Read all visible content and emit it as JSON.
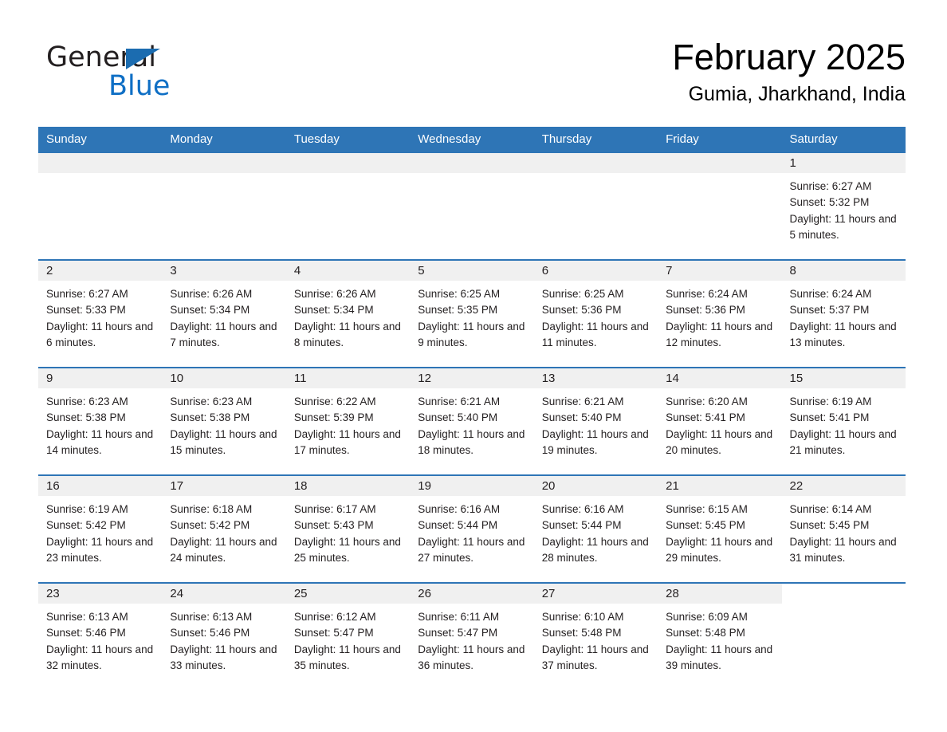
{
  "brand": {
    "name_part1": "General",
    "name_part2": "Blue",
    "triangle_color": "#1b6cb0",
    "blue_color": "#0f6fc5"
  },
  "header": {
    "month_title": "February 2025",
    "location": "Gumia, Jharkhand, India"
  },
  "theme": {
    "header_blue": "#2e75b6",
    "daynum_band_gray": "#f0f0f0",
    "text_color": "#231f20",
    "page_background": "#ffffff"
  },
  "calendar": {
    "weekday_headers": [
      "Sunday",
      "Monday",
      "Tuesday",
      "Wednesday",
      "Thursday",
      "Friday",
      "Saturday"
    ],
    "labels": {
      "sunrise": "Sunrise:",
      "sunset": "Sunset:",
      "daylight": "Daylight:"
    },
    "weeks": [
      [
        {
          "day": "",
          "empty": true
        },
        {
          "day": "",
          "empty": true
        },
        {
          "day": "",
          "empty": true
        },
        {
          "day": "",
          "empty": true
        },
        {
          "day": "",
          "empty": true
        },
        {
          "day": "",
          "empty": true
        },
        {
          "day": "1",
          "sunrise": "Sunrise: 6:27 AM",
          "sunset": "Sunset: 5:32 PM",
          "daylight": "Daylight: 11 hours and 5 minutes."
        }
      ],
      [
        {
          "day": "2",
          "sunrise": "Sunrise: 6:27 AM",
          "sunset": "Sunset: 5:33 PM",
          "daylight": "Daylight: 11 hours and 6 minutes."
        },
        {
          "day": "3",
          "sunrise": "Sunrise: 6:26 AM",
          "sunset": "Sunset: 5:34 PM",
          "daylight": "Daylight: 11 hours and 7 minutes."
        },
        {
          "day": "4",
          "sunrise": "Sunrise: 6:26 AM",
          "sunset": "Sunset: 5:34 PM",
          "daylight": "Daylight: 11 hours and 8 minutes."
        },
        {
          "day": "5",
          "sunrise": "Sunrise: 6:25 AM",
          "sunset": "Sunset: 5:35 PM",
          "daylight": "Daylight: 11 hours and 9 minutes."
        },
        {
          "day": "6",
          "sunrise": "Sunrise: 6:25 AM",
          "sunset": "Sunset: 5:36 PM",
          "daylight": "Daylight: 11 hours and 11 minutes."
        },
        {
          "day": "7",
          "sunrise": "Sunrise: 6:24 AM",
          "sunset": "Sunset: 5:36 PM",
          "daylight": "Daylight: 11 hours and 12 minutes."
        },
        {
          "day": "8",
          "sunrise": "Sunrise: 6:24 AM",
          "sunset": "Sunset: 5:37 PM",
          "daylight": "Daylight: 11 hours and 13 minutes."
        }
      ],
      [
        {
          "day": "9",
          "sunrise": "Sunrise: 6:23 AM",
          "sunset": "Sunset: 5:38 PM",
          "daylight": "Daylight: 11 hours and 14 minutes."
        },
        {
          "day": "10",
          "sunrise": "Sunrise: 6:23 AM",
          "sunset": "Sunset: 5:38 PM",
          "daylight": "Daylight: 11 hours and 15 minutes."
        },
        {
          "day": "11",
          "sunrise": "Sunrise: 6:22 AM",
          "sunset": "Sunset: 5:39 PM",
          "daylight": "Daylight: 11 hours and 17 minutes."
        },
        {
          "day": "12",
          "sunrise": "Sunrise: 6:21 AM",
          "sunset": "Sunset: 5:40 PM",
          "daylight": "Daylight: 11 hours and 18 minutes."
        },
        {
          "day": "13",
          "sunrise": "Sunrise: 6:21 AM",
          "sunset": "Sunset: 5:40 PM",
          "daylight": "Daylight: 11 hours and 19 minutes."
        },
        {
          "day": "14",
          "sunrise": "Sunrise: 6:20 AM",
          "sunset": "Sunset: 5:41 PM",
          "daylight": "Daylight: 11 hours and 20 minutes."
        },
        {
          "day": "15",
          "sunrise": "Sunrise: 6:19 AM",
          "sunset": "Sunset: 5:41 PM",
          "daylight": "Daylight: 11 hours and 21 minutes."
        }
      ],
      [
        {
          "day": "16",
          "sunrise": "Sunrise: 6:19 AM",
          "sunset": "Sunset: 5:42 PM",
          "daylight": "Daylight: 11 hours and 23 minutes."
        },
        {
          "day": "17",
          "sunrise": "Sunrise: 6:18 AM",
          "sunset": "Sunset: 5:42 PM",
          "daylight": "Daylight: 11 hours and 24 minutes."
        },
        {
          "day": "18",
          "sunrise": "Sunrise: 6:17 AM",
          "sunset": "Sunset: 5:43 PM",
          "daylight": "Daylight: 11 hours and 25 minutes."
        },
        {
          "day": "19",
          "sunrise": "Sunrise: 6:16 AM",
          "sunset": "Sunset: 5:44 PM",
          "daylight": "Daylight: 11 hours and 27 minutes."
        },
        {
          "day": "20",
          "sunrise": "Sunrise: 6:16 AM",
          "sunset": "Sunset: 5:44 PM",
          "daylight": "Daylight: 11 hours and 28 minutes."
        },
        {
          "day": "21",
          "sunrise": "Sunrise: 6:15 AM",
          "sunset": "Sunset: 5:45 PM",
          "daylight": "Daylight: 11 hours and 29 minutes."
        },
        {
          "day": "22",
          "sunrise": "Sunrise: 6:14 AM",
          "sunset": "Sunset: 5:45 PM",
          "daylight": "Daylight: 11 hours and 31 minutes."
        }
      ],
      [
        {
          "day": "23",
          "sunrise": "Sunrise: 6:13 AM",
          "sunset": "Sunset: 5:46 PM",
          "daylight": "Daylight: 11 hours and 32 minutes."
        },
        {
          "day": "24",
          "sunrise": "Sunrise: 6:13 AM",
          "sunset": "Sunset: 5:46 PM",
          "daylight": "Daylight: 11 hours and 33 minutes."
        },
        {
          "day": "25",
          "sunrise": "Sunrise: 6:12 AM",
          "sunset": "Sunset: 5:47 PM",
          "daylight": "Daylight: 11 hours and 35 minutes."
        },
        {
          "day": "26",
          "sunrise": "Sunrise: 6:11 AM",
          "sunset": "Sunset: 5:47 PM",
          "daylight": "Daylight: 11 hours and 36 minutes."
        },
        {
          "day": "27",
          "sunrise": "Sunrise: 6:10 AM",
          "sunset": "Sunset: 5:48 PM",
          "daylight": "Daylight: 11 hours and 37 minutes."
        },
        {
          "day": "28",
          "sunrise": "Sunrise: 6:09 AM",
          "sunset": "Sunset: 5:48 PM",
          "daylight": "Daylight: 11 hours and 39 minutes."
        },
        {
          "day": "",
          "empty": true,
          "no_band": true
        }
      ]
    ]
  }
}
